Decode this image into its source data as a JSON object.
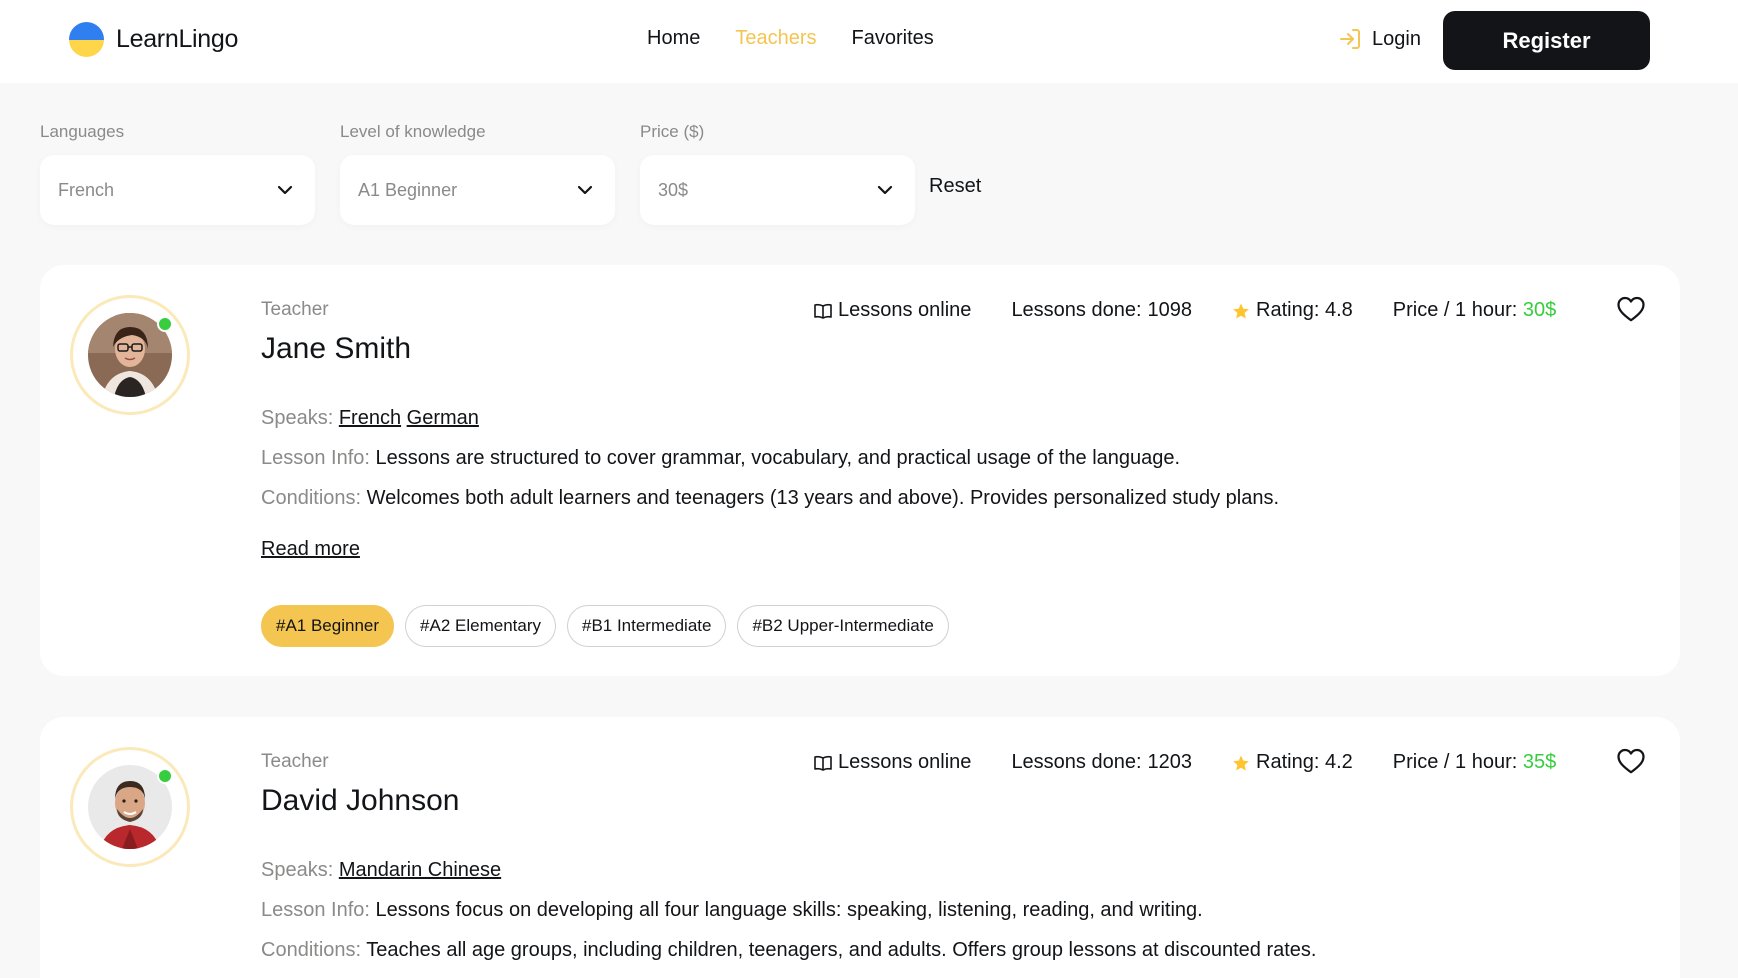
{
  "header": {
    "logo_text": "LearnLingo",
    "nav": [
      {
        "label": "Home",
        "active": false
      },
      {
        "label": "Teachers",
        "active": true
      },
      {
        "label": "Favorites",
        "active": false
      }
    ],
    "login_label": "Login",
    "register_label": "Register"
  },
  "filters": {
    "languages": {
      "label": "Languages",
      "value": "French"
    },
    "level": {
      "label": "Level of knowledge",
      "value": "A1 Beginner"
    },
    "price": {
      "label": "Price ($)",
      "value": "30$"
    },
    "reset_label": "Reset"
  },
  "teachers": [
    {
      "role": "Teacher",
      "name": "Jane Smith",
      "lessons_online": "Lessons online",
      "lessons_done_label": "Lessons done: ",
      "lessons_done": "1098",
      "rating_label": "Rating: ",
      "rating": "4.8",
      "price_label": "Price / 1 hour: ",
      "price": "30$",
      "speaks_label": "Speaks: ",
      "languages": [
        "French",
        "German"
      ],
      "lesson_info_label": "Lesson Info: ",
      "lesson_info": "Lessons are structured to cover grammar, vocabulary, and practical usage of the language.",
      "conditions_label": "Conditions: ",
      "conditions": "Welcomes both adult learners and teenagers (13 years and above). Provides personalized study plans.",
      "read_more": "Read more",
      "levels": [
        "#A1 Beginner",
        "#A2 Elementary",
        "#B1 Intermediate",
        "#B2 Upper-Intermediate"
      ],
      "active_level": "#A1 Beginner"
    },
    {
      "role": "Teacher",
      "name": "David Johnson",
      "lessons_online": "Lessons online",
      "lessons_done_label": "Lessons done: ",
      "lessons_done": "1203",
      "rating_label": "Rating: ",
      "rating": "4.2",
      "price_label": "Price / 1 hour: ",
      "price": "35$",
      "speaks_label": "Speaks: ",
      "languages": [
        "Mandarin Chinese"
      ],
      "lesson_info_label": "Lesson Info: ",
      "lesson_info": "Lessons focus on developing all four language skills: speaking, listening, reading, and writing.",
      "conditions_label": "Conditions: ",
      "conditions": "Teaches all age groups, including children, teenagers, and adults. Offers group lessons at discounted rates."
    }
  ],
  "colors": {
    "accent": "#f4c550",
    "dark": "#121417",
    "muted": "#8a8a89",
    "price_green": "#38cd3e",
    "online_dot": "#38cd3e"
  },
  "icons": [
    "login-arrow-icon",
    "chevron-down-icon",
    "book-icon",
    "star-icon",
    "heart-icon"
  ]
}
